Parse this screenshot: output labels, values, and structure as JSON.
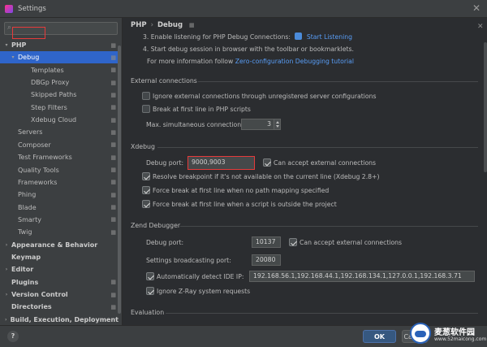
{
  "window": {
    "title": "Settings"
  },
  "sidebar": {
    "search_placeholder": "",
    "items": [
      {
        "label": "PHP",
        "level": 0,
        "arrow": "▾",
        "bold": true,
        "gear": true,
        "selected": false
      },
      {
        "label": "Debug",
        "level": 1,
        "arrow": "▾",
        "bold": false,
        "gear": true,
        "selected": true
      },
      {
        "label": "Templates",
        "level": 2,
        "arrow": "",
        "bold": false,
        "gear": true,
        "selected": false
      },
      {
        "label": "DBGp Proxy",
        "level": 2,
        "arrow": "",
        "bold": false,
        "gear": true,
        "selected": false
      },
      {
        "label": "Skipped Paths",
        "level": 2,
        "arrow": "",
        "bold": false,
        "gear": true,
        "selected": false
      },
      {
        "label": "Step Filters",
        "level": 2,
        "arrow": "",
        "bold": false,
        "gear": true,
        "selected": false
      },
      {
        "label": "Xdebug Cloud",
        "level": 2,
        "arrow": "",
        "bold": false,
        "gear": true,
        "selected": false
      },
      {
        "label": "Servers",
        "level": 1,
        "arrow": "",
        "bold": false,
        "gear": true,
        "selected": false
      },
      {
        "label": "Composer",
        "level": 1,
        "arrow": "",
        "bold": false,
        "gear": true,
        "selected": false
      },
      {
        "label": "Test Frameworks",
        "level": 1,
        "arrow": "",
        "bold": false,
        "gear": true,
        "selected": false
      },
      {
        "label": "Quality Tools",
        "level": 1,
        "arrow": "",
        "bold": false,
        "gear": true,
        "selected": false
      },
      {
        "label": "Frameworks",
        "level": 1,
        "arrow": "",
        "bold": false,
        "gear": true,
        "selected": false
      },
      {
        "label": "Phing",
        "level": 1,
        "arrow": "",
        "bold": false,
        "gear": true,
        "selected": false
      },
      {
        "label": "Blade",
        "level": 1,
        "arrow": "",
        "bold": false,
        "gear": true,
        "selected": false
      },
      {
        "label": "Smarty",
        "level": 1,
        "arrow": "",
        "bold": false,
        "gear": true,
        "selected": false
      },
      {
        "label": "Twig",
        "level": 1,
        "arrow": "",
        "bold": false,
        "gear": true,
        "selected": false
      },
      {
        "label": "Appearance & Behavior",
        "level": 0,
        "arrow": "›",
        "bold": true,
        "gear": false,
        "selected": false
      },
      {
        "label": "Keymap",
        "level": 0,
        "arrow": "",
        "bold": true,
        "gear": false,
        "selected": false
      },
      {
        "label": "Editor",
        "level": 0,
        "arrow": "›",
        "bold": true,
        "gear": false,
        "selected": false
      },
      {
        "label": "Plugins",
        "level": 0,
        "arrow": "",
        "bold": true,
        "gear": true,
        "selected": false
      },
      {
        "label": "Version Control",
        "level": 0,
        "arrow": "›",
        "bold": true,
        "gear": true,
        "selected": false
      },
      {
        "label": "Directories",
        "level": 0,
        "arrow": "",
        "bold": true,
        "gear": true,
        "selected": false
      },
      {
        "label": "Build, Execution, Deployment",
        "level": 0,
        "arrow": "›",
        "bold": true,
        "gear": false,
        "selected": false
      }
    ]
  },
  "breadcrumb": {
    "parent": "PHP",
    "separator": "›",
    "current": "Debug"
  },
  "instructions": {
    "step3_prefix": "3. Enable listening for PHP Debug Connections:",
    "step3_link": "Start Listening",
    "step4": "4. Start debug session in browser with the toolbar or bookmarklets.",
    "info_prefix": "For more information follow",
    "info_link": "Zero-configuration Debugging tutorial"
  },
  "external_connections": {
    "title": "External connections",
    "ignore_unregistered": {
      "label": "Ignore external connections through unregistered server configurations",
      "checked": false
    },
    "break_first_line": {
      "label": "Break at first line in PHP scripts",
      "checked": false
    },
    "max_connections_label": "Max. simultaneous connections:",
    "max_connections_value": "3"
  },
  "xdebug": {
    "title": "Xdebug",
    "debug_port_label": "Debug port:",
    "debug_port_value": "9000,9003",
    "can_accept": {
      "label": "Can accept external connections",
      "checked": true
    },
    "resolve_breakpoint": {
      "label": "Resolve breakpoint if it's not available on the current line (Xdebug 2.8+)",
      "checked": true
    },
    "force_break_no_mapping": {
      "label": "Force break at first line when no path mapping specified",
      "checked": true
    },
    "force_break_outside": {
      "label": "Force break at first line when a script is outside the project",
      "checked": true
    }
  },
  "zend_debugger": {
    "title": "Zend Debugger",
    "debug_port_label": "Debug port:",
    "debug_port_value": "10137",
    "can_accept": {
      "label": "Can accept external connections",
      "checked": true
    },
    "broadcast_port_label": "Settings broadcasting port:",
    "broadcast_port_value": "20080",
    "auto_detect": {
      "label": "Automatically detect IDE IP:",
      "checked": true
    },
    "ide_ip_value": "192.168.56.1,192.168.44.1,192.168.134.1,127.0.0.1,192.168.3.71",
    "ignore_zray": {
      "label": "Ignore Z-Ray system requests",
      "checked": true
    }
  },
  "evaluation": {
    "title": "Evaluation"
  },
  "footer": {
    "help": "?",
    "ok": "OK",
    "cancel": "Cancel"
  },
  "watermark": {
    "name": "麦葱软件园",
    "url": "www.52maicong.com"
  },
  "colors": {
    "accent": "#2f65ca",
    "link": "#589df6",
    "highlight": "#e53b3b",
    "ok_button": "#365880",
    "background": "#2b2d30",
    "panel": "#3c3f41"
  }
}
